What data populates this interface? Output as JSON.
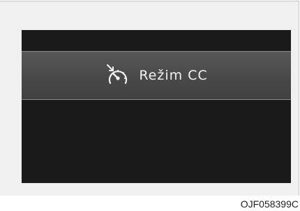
{
  "display": {
    "mode_label": "Režim CC",
    "icon": "cruise-control-icon"
  },
  "figure_code": "OJF058399C",
  "colors": {
    "screen_background": "#1a1a1a",
    "band_background": "#4a4a4a",
    "text": "#f2f2f2",
    "frame_background": "#f0f0f0"
  }
}
